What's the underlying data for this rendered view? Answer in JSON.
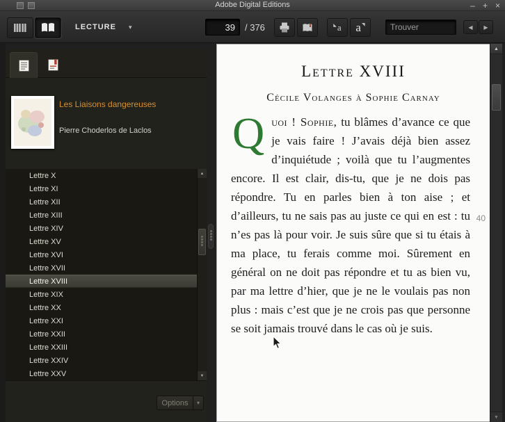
{
  "window": {
    "title": "Adobe Digital Editions"
  },
  "icons": {
    "minimize": "–",
    "maximize": "+",
    "close": "×",
    "caret_down": "▾",
    "scroll_up": "▲",
    "scroll_down": "▼",
    "nav_prev": "◀",
    "nav_next": "▶",
    "font_decrease_mark": "◣",
    "font_increase_mark": "◥"
  },
  "toolbar": {
    "mode_label": "LECTURE",
    "page_value": "39",
    "page_total": "/ 376",
    "font_letter": "a",
    "search_placeholder": "Trouver"
  },
  "sidebar": {
    "book_title": "Les Liaisons dangereuses",
    "book_author": "Pierre Choderlos de Laclos",
    "toc_items": [
      "Lettre X",
      "Lettre XI",
      "Lettre XII",
      "Lettre XIII",
      "Lettre XIV",
      "Lettre XV",
      "Lettre XVI",
      "Lettre XVII",
      "Lettre XVIII",
      "Lettre XIX",
      "Lettre XX",
      "Lettre XXI",
      "Lettre XXII",
      "Lettre XXIII",
      "Lettre XXIV",
      "Lettre XXV"
    ],
    "selected_item": "Lettre XVIII",
    "options_label": "Options"
  },
  "page": {
    "heading": "Lettre XVIII",
    "subheading": "Cécile Volanges à Sophie Carnay",
    "dropcap": "Q",
    "opening": "uoi ! Sophie,",
    "body": " tu blâmes d’avance ce que je vais faire ! J’avais déjà bien assez d’inquiétude ; voilà que tu l’augmentes encore. Il est clair, dis-tu, que je ne dois pas répondre. Tu en parles bien à ton aise ; et d’ailleurs, tu ne sais pas au juste ce qui en est : tu n’es pas là pour voir. Je suis sûre que si tu étais à ma place, tu ferais comme moi. Sûrement en général on ne doit pas répondre et tu as bien vu, par ma lettre d’hier, que je ne le voulais pas non plus : mais c’est que je ne crois pas que personne se soit jamais trouvé dans le cas où je suis.",
    "page_number": "40"
  },
  "colors": {
    "accent_orange": "#d78f2f",
    "dropcap_green": "#2f7a33"
  }
}
